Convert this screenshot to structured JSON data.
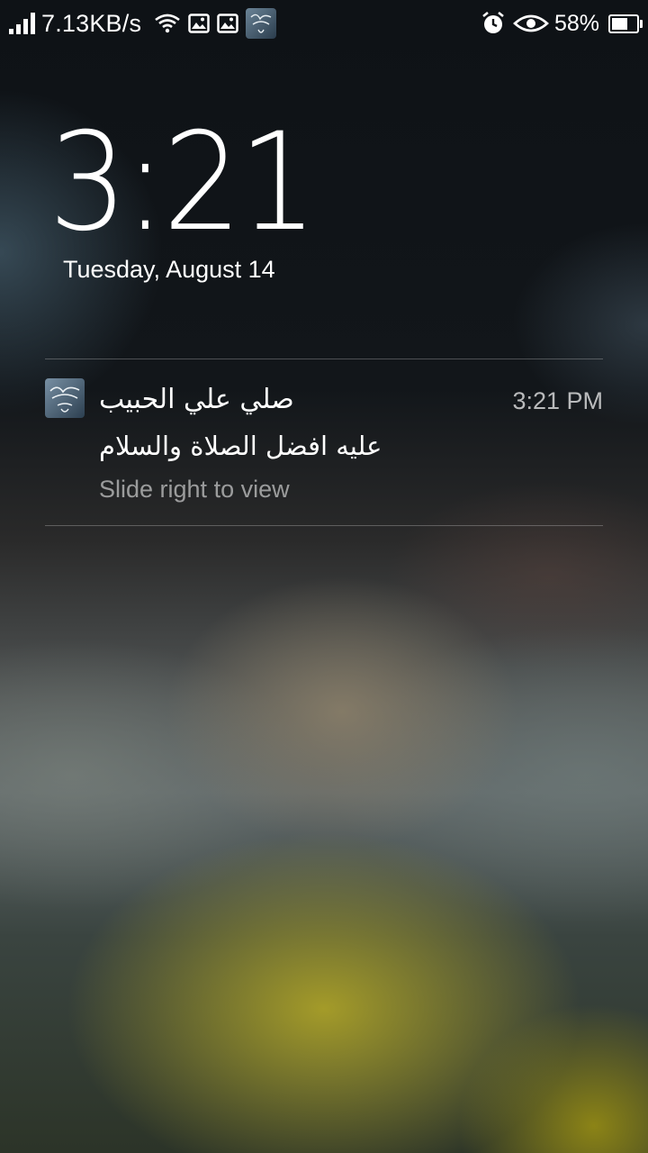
{
  "status_bar": {
    "network_speed": "7.13KB/s",
    "battery_percent": "58%",
    "battery_level": 0.58,
    "icons_left": [
      "signal-icon",
      "wifi-icon",
      "image-icon",
      "image-icon",
      "app-notification-icon"
    ],
    "icons_right": [
      "alarm-icon",
      "eye-icon",
      "battery-icon"
    ]
  },
  "lock_screen": {
    "time": "3:21",
    "date": "Tuesday, August 14"
  },
  "notification": {
    "title": "صلي علي الحبيب",
    "body": "عليه افضل الصلاة والسلام",
    "time": "3:21 PM",
    "hint": "Slide right to view",
    "icon": "calligraphy-app-icon"
  }
}
